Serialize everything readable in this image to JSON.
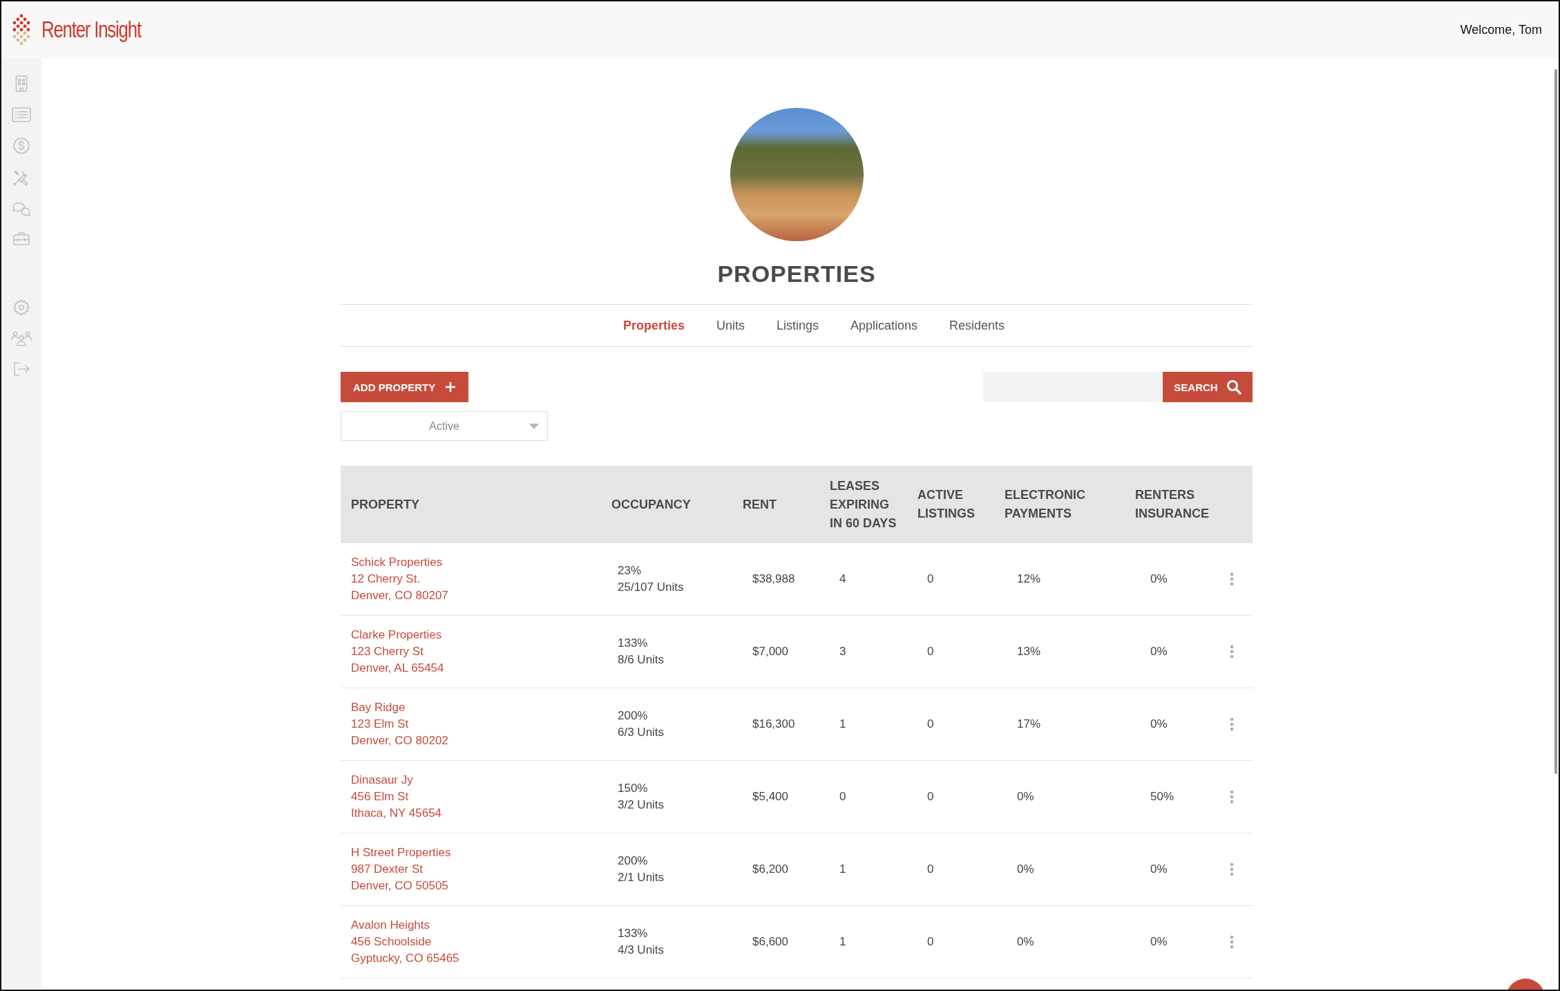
{
  "header": {
    "logo_text": "Renter Insight",
    "welcome": "Welcome, Tom"
  },
  "page_title": "PROPERTIES",
  "tabs": [
    {
      "label": "Properties",
      "selected": true
    },
    {
      "label": "Units",
      "selected": false
    },
    {
      "label": "Listings",
      "selected": false
    },
    {
      "label": "Applications",
      "selected": false
    },
    {
      "label": "Residents",
      "selected": false
    }
  ],
  "add_button": "ADD PROPERTY",
  "search": {
    "button": "SEARCH"
  },
  "status_filter": {
    "value": "Active"
  },
  "table": {
    "columns": [
      "PROPERTY",
      "OCCUPANCY",
      "RENT",
      "LEASES EXPIRING IN 60 DAYS",
      "ACTIVE LISTINGS",
      "ELECTRONIC PAYMENTS",
      "RENTERS INSURANCE"
    ],
    "rows": [
      {
        "name": "Schick Properties",
        "street": "12 Cherry St.",
        "city": "Denver, CO 80207",
        "occupancy": "23%",
        "units": "25/107 Units",
        "rent": "$38,988",
        "leases_expiring": "4",
        "active_listings": "0",
        "electronic_payments": "12%",
        "renters_insurance": "0%"
      },
      {
        "name": "Clarke Properties",
        "street": "123 Cherry St",
        "city": "Denver, AL 65454",
        "occupancy": "133%",
        "units": "8/6 Units",
        "rent": "$7,000",
        "leases_expiring": "3",
        "active_listings": "0",
        "electronic_payments": "13%",
        "renters_insurance": "0%"
      },
      {
        "name": "Bay Ridge",
        "street": "123 Elm St",
        "city": "Denver, CO 80202",
        "occupancy": "200%",
        "units": "6/3 Units",
        "rent": "$16,300",
        "leases_expiring": "1",
        "active_listings": "0",
        "electronic_payments": "17%",
        "renters_insurance": "0%"
      },
      {
        "name": "Dinasaur Jy",
        "street": "456 Elm St",
        "city": "Ithaca, NY 45654",
        "occupancy": "150%",
        "units": "3/2 Units",
        "rent": "$5,400",
        "leases_expiring": "0",
        "active_listings": "0",
        "electronic_payments": "0%",
        "renters_insurance": "50%"
      },
      {
        "name": "H Street Properties",
        "street": "987 Dexter St",
        "city": "Denver, CO 50505",
        "occupancy": "200%",
        "units": "2/1 Units",
        "rent": "$6,200",
        "leases_expiring": "1",
        "active_listings": "0",
        "electronic_payments": "0%",
        "renters_insurance": "0%"
      },
      {
        "name": "Avalon Heights",
        "street": "456 Schoolside",
        "city": "Gyptucky, CO 65465",
        "occupancy": "133%",
        "units": "4/3 Units",
        "rent": "$6,600",
        "leases_expiring": "1",
        "active_listings": "0",
        "electronic_payments": "0%",
        "renters_insurance": "0%"
      }
    ]
  }
}
